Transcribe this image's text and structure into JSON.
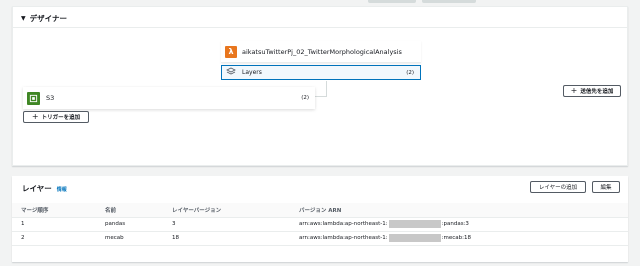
{
  "designer": {
    "title": "デザイナー",
    "function_name": "aikatsuTwitterPj_02_TwitterMorphologicalAnalysis",
    "layers_label": "Layers",
    "layers_count": "(2)",
    "trigger_name": "S3",
    "trigger_count": "(2)",
    "add_trigger_label": "トリガーを追加",
    "add_destination_label": "送信先を追加"
  },
  "layers": {
    "title": "レイヤー",
    "info_link": "情報",
    "add_layer_label": "レイヤーの追加",
    "edit_label": "編集",
    "columns": [
      "マージ順序",
      "名前",
      "レイヤーバージョン",
      "バージョン ARN"
    ],
    "rows": [
      {
        "order": "1",
        "name": "pandas",
        "version": "3",
        "arn_prefix": "arn:aws:lambda:ap-northeast-1:",
        "arn_suffix": ":pandas:3"
      },
      {
        "order": "2",
        "name": "mecab",
        "version": "18",
        "arn_prefix": "arn:aws:lambda:ap-northeast-1:",
        "arn_suffix": ":mecab:18"
      }
    ]
  },
  "colors": {
    "accent": "#0073bb",
    "lambda": "#e8761e",
    "s3": "#3f8624",
    "background": "#f2f3f3"
  },
  "icons": {
    "function": "lambda-icon",
    "layers": "layers-icon",
    "trigger": "s3-bucket-icon",
    "add": "plus-icon",
    "collapse": "caret-down-icon"
  }
}
